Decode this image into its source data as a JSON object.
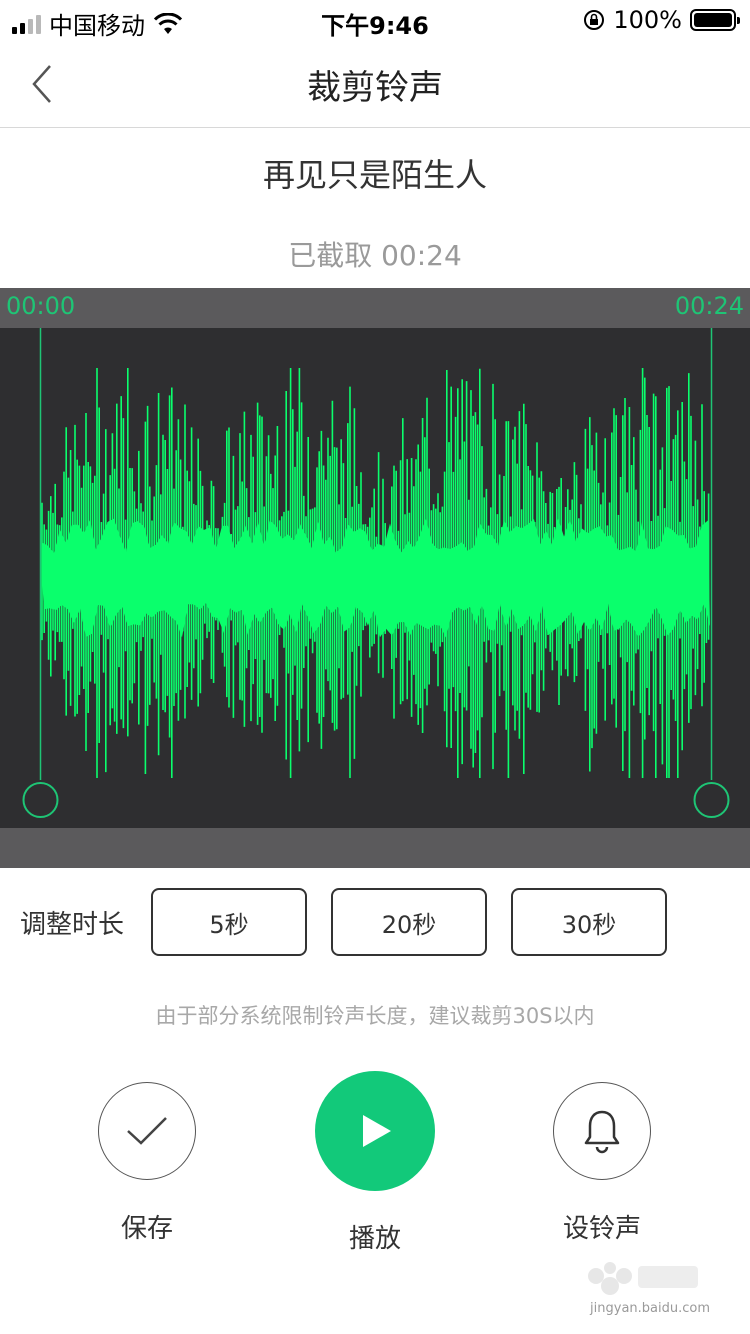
{
  "status_bar": {
    "carrier": "中国移动",
    "time": "下午9:46",
    "battery": "100%"
  },
  "nav": {
    "title": "裁剪铃声"
  },
  "song": {
    "title": "再见只是陌生人",
    "clip_info": "已截取 00:24"
  },
  "waveform": {
    "start_time": "00:00",
    "end_time": "00:24",
    "color": "#0aff6c",
    "handle_color": "#1ec575"
  },
  "duration": {
    "label": "调整时长",
    "options": [
      "5秒",
      "20秒",
      "30秒"
    ]
  },
  "hint": "由于部分系统限制铃声长度，建议裁剪30S以内",
  "actions": {
    "save": "保存",
    "play": "播放",
    "set_ringtone": "设铃声"
  },
  "colors": {
    "accent": "#12c97a",
    "panel_dark": "#2e2e30",
    "panel_mid": "#5b5a5c"
  },
  "watermark": {
    "url": "jingyan.baidu.com"
  }
}
